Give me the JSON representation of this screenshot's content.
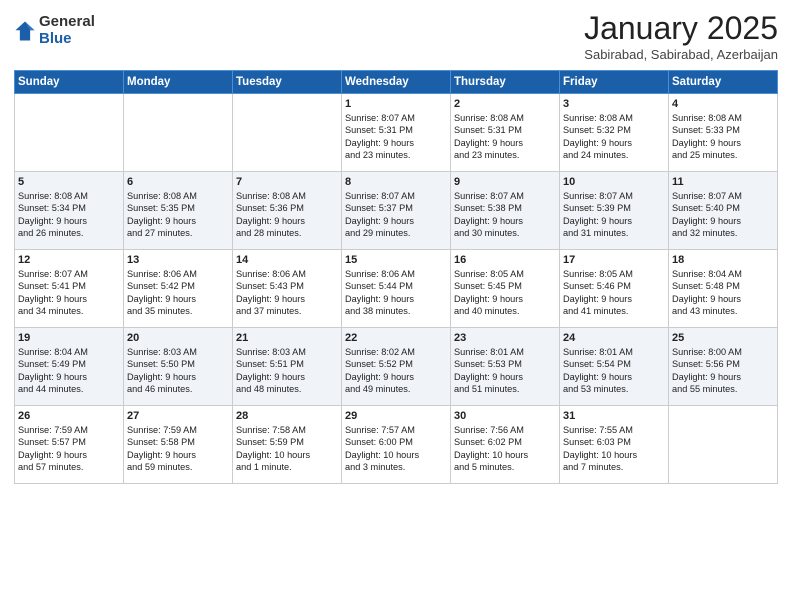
{
  "logo": {
    "general": "General",
    "blue": "Blue"
  },
  "title": "January 2025",
  "location": "Sabirabad, Sabirabad, Azerbaijan",
  "days_header": [
    "Sunday",
    "Monday",
    "Tuesday",
    "Wednesday",
    "Thursday",
    "Friday",
    "Saturday"
  ],
  "weeks": [
    [
      {
        "day": "",
        "info": ""
      },
      {
        "day": "",
        "info": ""
      },
      {
        "day": "",
        "info": ""
      },
      {
        "day": "1",
        "info": "Sunrise: 8:07 AM\nSunset: 5:31 PM\nDaylight: 9 hours\nand 23 minutes."
      },
      {
        "day": "2",
        "info": "Sunrise: 8:08 AM\nSunset: 5:31 PM\nDaylight: 9 hours\nand 23 minutes."
      },
      {
        "day": "3",
        "info": "Sunrise: 8:08 AM\nSunset: 5:32 PM\nDaylight: 9 hours\nand 24 minutes."
      },
      {
        "day": "4",
        "info": "Sunrise: 8:08 AM\nSunset: 5:33 PM\nDaylight: 9 hours\nand 25 minutes."
      }
    ],
    [
      {
        "day": "5",
        "info": "Sunrise: 8:08 AM\nSunset: 5:34 PM\nDaylight: 9 hours\nand 26 minutes."
      },
      {
        "day": "6",
        "info": "Sunrise: 8:08 AM\nSunset: 5:35 PM\nDaylight: 9 hours\nand 27 minutes."
      },
      {
        "day": "7",
        "info": "Sunrise: 8:08 AM\nSunset: 5:36 PM\nDaylight: 9 hours\nand 28 minutes."
      },
      {
        "day": "8",
        "info": "Sunrise: 8:07 AM\nSunset: 5:37 PM\nDaylight: 9 hours\nand 29 minutes."
      },
      {
        "day": "9",
        "info": "Sunrise: 8:07 AM\nSunset: 5:38 PM\nDaylight: 9 hours\nand 30 minutes."
      },
      {
        "day": "10",
        "info": "Sunrise: 8:07 AM\nSunset: 5:39 PM\nDaylight: 9 hours\nand 31 minutes."
      },
      {
        "day": "11",
        "info": "Sunrise: 8:07 AM\nSunset: 5:40 PM\nDaylight: 9 hours\nand 32 minutes."
      }
    ],
    [
      {
        "day": "12",
        "info": "Sunrise: 8:07 AM\nSunset: 5:41 PM\nDaylight: 9 hours\nand 34 minutes."
      },
      {
        "day": "13",
        "info": "Sunrise: 8:06 AM\nSunset: 5:42 PM\nDaylight: 9 hours\nand 35 minutes."
      },
      {
        "day": "14",
        "info": "Sunrise: 8:06 AM\nSunset: 5:43 PM\nDaylight: 9 hours\nand 37 minutes."
      },
      {
        "day": "15",
        "info": "Sunrise: 8:06 AM\nSunset: 5:44 PM\nDaylight: 9 hours\nand 38 minutes."
      },
      {
        "day": "16",
        "info": "Sunrise: 8:05 AM\nSunset: 5:45 PM\nDaylight: 9 hours\nand 40 minutes."
      },
      {
        "day": "17",
        "info": "Sunrise: 8:05 AM\nSunset: 5:46 PM\nDaylight: 9 hours\nand 41 minutes."
      },
      {
        "day": "18",
        "info": "Sunrise: 8:04 AM\nSunset: 5:48 PM\nDaylight: 9 hours\nand 43 minutes."
      }
    ],
    [
      {
        "day": "19",
        "info": "Sunrise: 8:04 AM\nSunset: 5:49 PM\nDaylight: 9 hours\nand 44 minutes."
      },
      {
        "day": "20",
        "info": "Sunrise: 8:03 AM\nSunset: 5:50 PM\nDaylight: 9 hours\nand 46 minutes."
      },
      {
        "day": "21",
        "info": "Sunrise: 8:03 AM\nSunset: 5:51 PM\nDaylight: 9 hours\nand 48 minutes."
      },
      {
        "day": "22",
        "info": "Sunrise: 8:02 AM\nSunset: 5:52 PM\nDaylight: 9 hours\nand 49 minutes."
      },
      {
        "day": "23",
        "info": "Sunrise: 8:01 AM\nSunset: 5:53 PM\nDaylight: 9 hours\nand 51 minutes."
      },
      {
        "day": "24",
        "info": "Sunrise: 8:01 AM\nSunset: 5:54 PM\nDaylight: 9 hours\nand 53 minutes."
      },
      {
        "day": "25",
        "info": "Sunrise: 8:00 AM\nSunset: 5:56 PM\nDaylight: 9 hours\nand 55 minutes."
      }
    ],
    [
      {
        "day": "26",
        "info": "Sunrise: 7:59 AM\nSunset: 5:57 PM\nDaylight: 9 hours\nand 57 minutes."
      },
      {
        "day": "27",
        "info": "Sunrise: 7:59 AM\nSunset: 5:58 PM\nDaylight: 9 hours\nand 59 minutes."
      },
      {
        "day": "28",
        "info": "Sunrise: 7:58 AM\nSunset: 5:59 PM\nDaylight: 10 hours\nand 1 minute."
      },
      {
        "day": "29",
        "info": "Sunrise: 7:57 AM\nSunset: 6:00 PM\nDaylight: 10 hours\nand 3 minutes."
      },
      {
        "day": "30",
        "info": "Sunrise: 7:56 AM\nSunset: 6:02 PM\nDaylight: 10 hours\nand 5 minutes."
      },
      {
        "day": "31",
        "info": "Sunrise: 7:55 AM\nSunset: 6:03 PM\nDaylight: 10 hours\nand 7 minutes."
      },
      {
        "day": "",
        "info": ""
      }
    ]
  ]
}
